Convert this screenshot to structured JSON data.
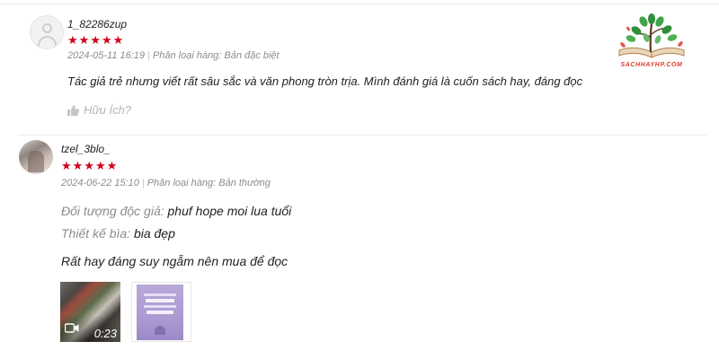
{
  "logo": {
    "text": "SACHHAYHP.COM"
  },
  "reviews": [
    {
      "username": "1_82286zup",
      "rating": 5,
      "date": "2024-05-11 16:19",
      "variation_label": "Phân loại hàng:",
      "variation": "Bản đặc biệt",
      "content": "Tác giả trẻ nhưng viết rất sâu sắc và văn phong tròn trịa. Mình đánh giá là cuốn sách hay, đáng đọc",
      "helpful_label": "Hữu Ích?"
    },
    {
      "username": "tzel_3blo_",
      "rating": 5,
      "date": "2024-06-22 15:10",
      "variation_label": "Phân loại hàng:",
      "variation": "Bản thường",
      "attributes": [
        {
          "key": "Đối tượng độc giả:",
          "value": "phuf hope moi lua tuổi"
        },
        {
          "key": "Thiết kế bìa:",
          "value": "bia đẹp"
        }
      ],
      "content": "Rất hay đáng suy ngẫm nên mua để đọc",
      "media": [
        {
          "type": "video",
          "duration": "0:23",
          "icon": "video-camera-icon"
        },
        {
          "type": "image",
          "icon": "book-cover-image"
        }
      ]
    }
  ],
  "colors": {
    "star": "#d0011b",
    "muted": "#8c8c8c",
    "logo_red": "#e03a2b"
  }
}
